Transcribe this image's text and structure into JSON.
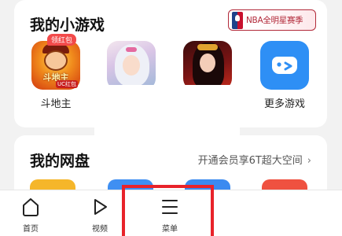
{
  "games_section": {
    "title": "我的小游戏",
    "banner_text": "NBA全明星赛季",
    "games": [
      {
        "label": "斗地主",
        "icon": "doudizhu-game-icon",
        "badge": "领红包",
        "icon_title": "斗地主",
        "icon_tag": "UC红包"
      },
      {
        "label": "",
        "icon": "fairy-game-icon"
      },
      {
        "label": "",
        "icon": "beauty-game-icon"
      },
      {
        "label": "更多游戏",
        "icon": "gamepad-icon"
      }
    ]
  },
  "disk_section": {
    "title": "我的网盘",
    "promo_link": "开通会员享6T超大空间",
    "tile_colors": [
      "#f5b62a",
      "#3f8ff2",
      "#3b8af0",
      "#ef5140"
    ]
  },
  "tabbar": {
    "tabs": [
      {
        "label": "首页",
        "icon": "home-icon"
      },
      {
        "label": "视频",
        "icon": "play-icon"
      },
      {
        "label": "菜单",
        "icon": "menu-icon"
      }
    ]
  },
  "colors": {
    "accent_blue": "#2e8ff5",
    "highlight_red": "#e8232a",
    "badge_red": "#f24a4a"
  }
}
